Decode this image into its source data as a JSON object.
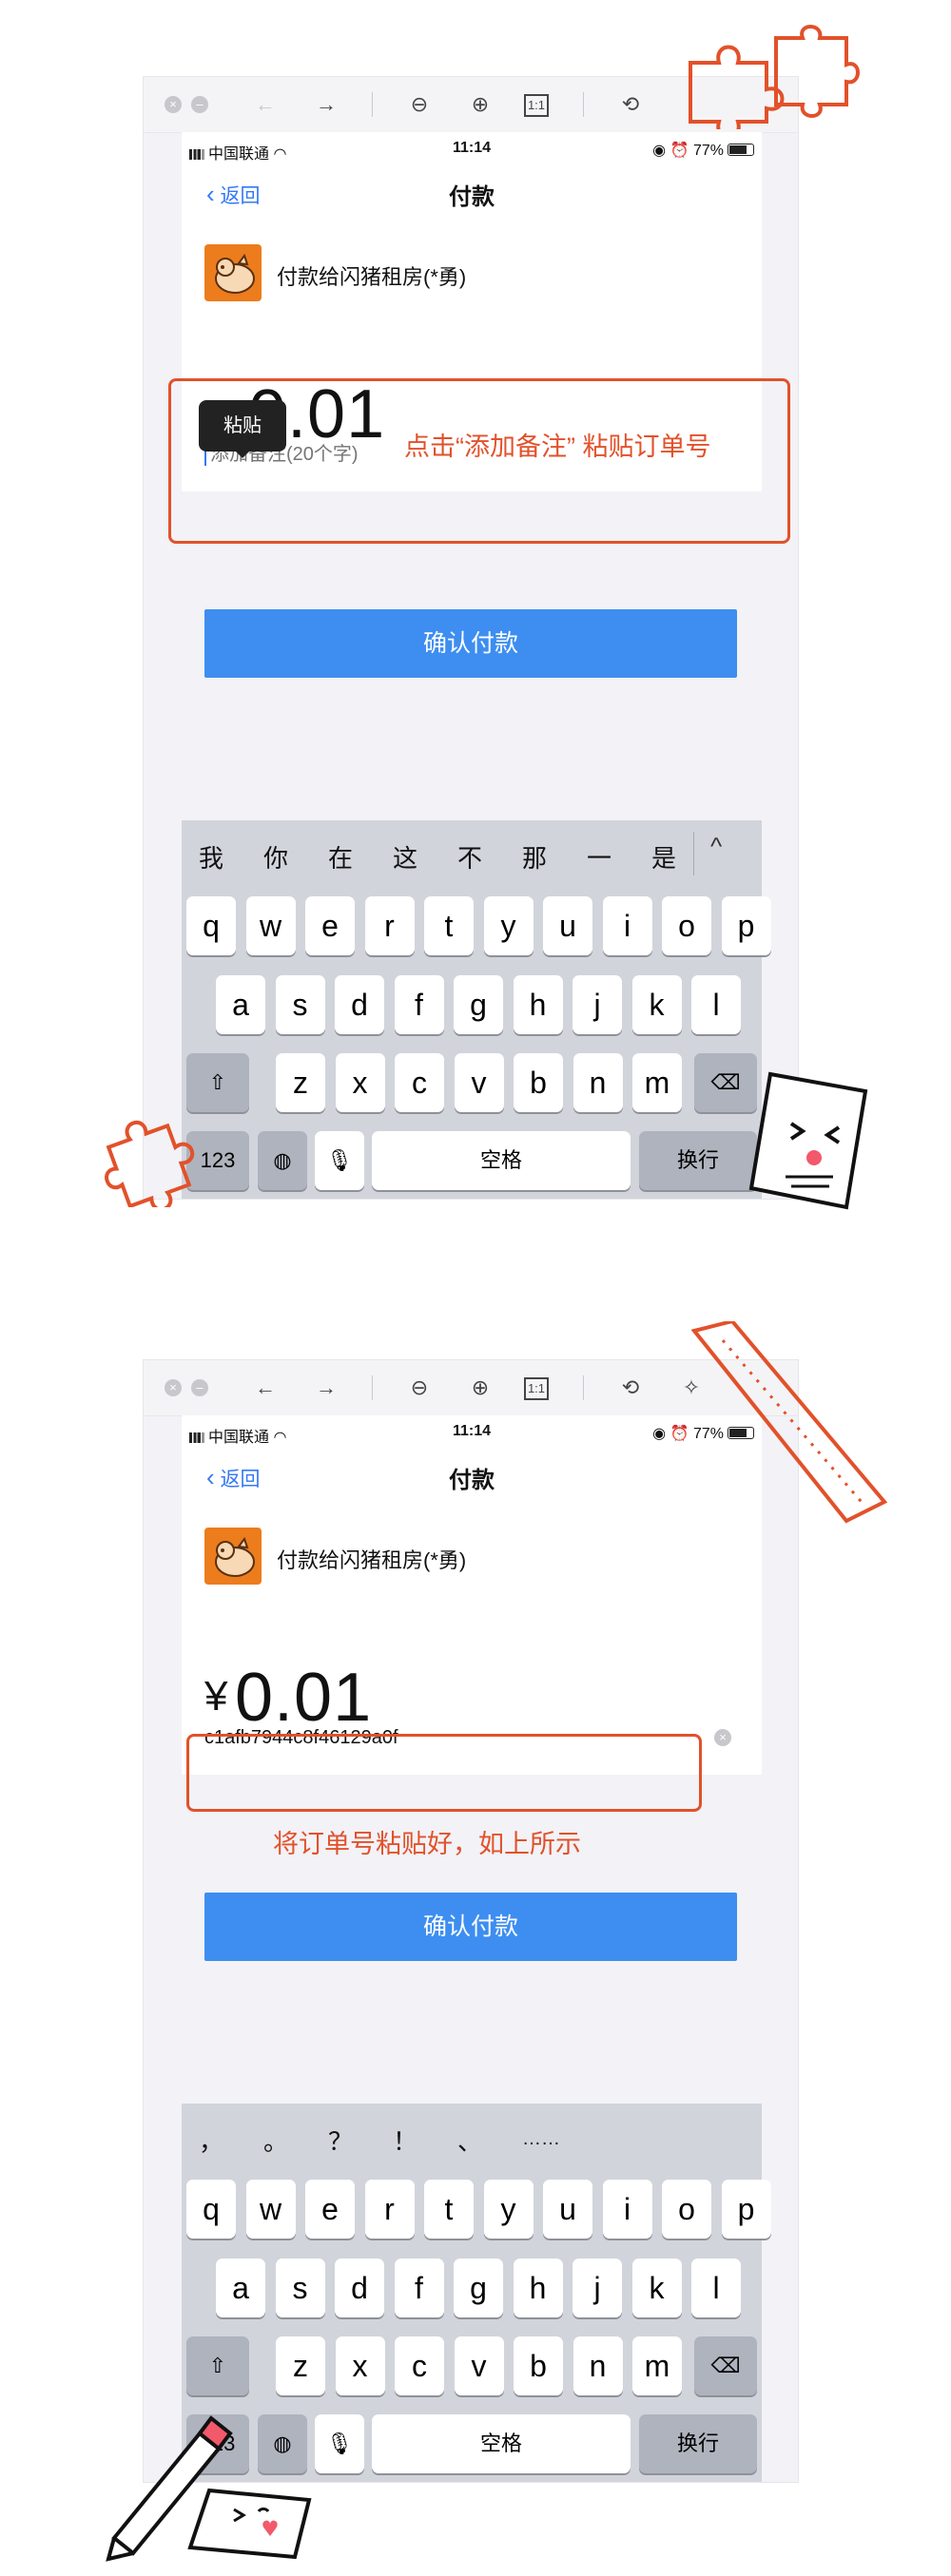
{
  "viewer_toolbar": {
    "icons": [
      "close-window-icon",
      "minimize-window-icon",
      "back-arrow-icon",
      "forward-arrow-icon",
      "zoom-out-icon",
      "zoom-in-icon",
      "actual-size-icon",
      "rotate-icon",
      "magic-wand-icon"
    ],
    "glyphs": {
      "close": "×",
      "min": "‒",
      "back": "←",
      "forward": "→",
      "zoom_out": "⊖",
      "zoom_in": "⊕",
      "actual_size": "1:1",
      "rotate": "⟲",
      "wand": "✧"
    }
  },
  "status_bar": {
    "carrier": "中国联通",
    "time": "11:14",
    "battery": "77%"
  },
  "nav": {
    "back_label": "返回",
    "title": "付款"
  },
  "payee": {
    "name": "付款给闪猪租房(*勇)"
  },
  "amount": {
    "currency": "¥",
    "value": "0.01"
  },
  "note": {
    "placeholder": "添加备注(20个字)",
    "pasted_value": "c1afb7944c8f46129a0f"
  },
  "tooltip": {
    "paste_label": "粘贴"
  },
  "confirm_button": {
    "label": "确认付款"
  },
  "keyboard": {
    "candidates_panel1": [
      "我",
      "你",
      "在",
      "这",
      "不",
      "那",
      "一",
      "是"
    ],
    "candidates_panel2": [
      "，",
      "。",
      "？",
      "！",
      "、",
      "……"
    ],
    "toggle_glyph": "^",
    "row1": [
      "q",
      "w",
      "e",
      "r",
      "t",
      "y",
      "u",
      "i",
      "o",
      "p"
    ],
    "row2": [
      "a",
      "s",
      "d",
      "f",
      "g",
      "h",
      "j",
      "k",
      "l"
    ],
    "row3": [
      "z",
      "x",
      "c",
      "v",
      "b",
      "n",
      "m"
    ],
    "shift_glyph": "⇧",
    "delete_glyph": "⌫",
    "numbers_label": "123",
    "globe_glyph": "◍",
    "mic_glyph": "🎙",
    "space_label": "空格",
    "return_label": "换行"
  },
  "annotations": {
    "step1": "点击“添加备注” 粘贴订单号",
    "step2": "将订单号粘贴好，如上所示"
  },
  "colors": {
    "annotation": "#e2512a",
    "confirm": "#3d8ef0",
    "ios_blue": "#3478f6",
    "keyboard_bg": "#d1d4db"
  }
}
